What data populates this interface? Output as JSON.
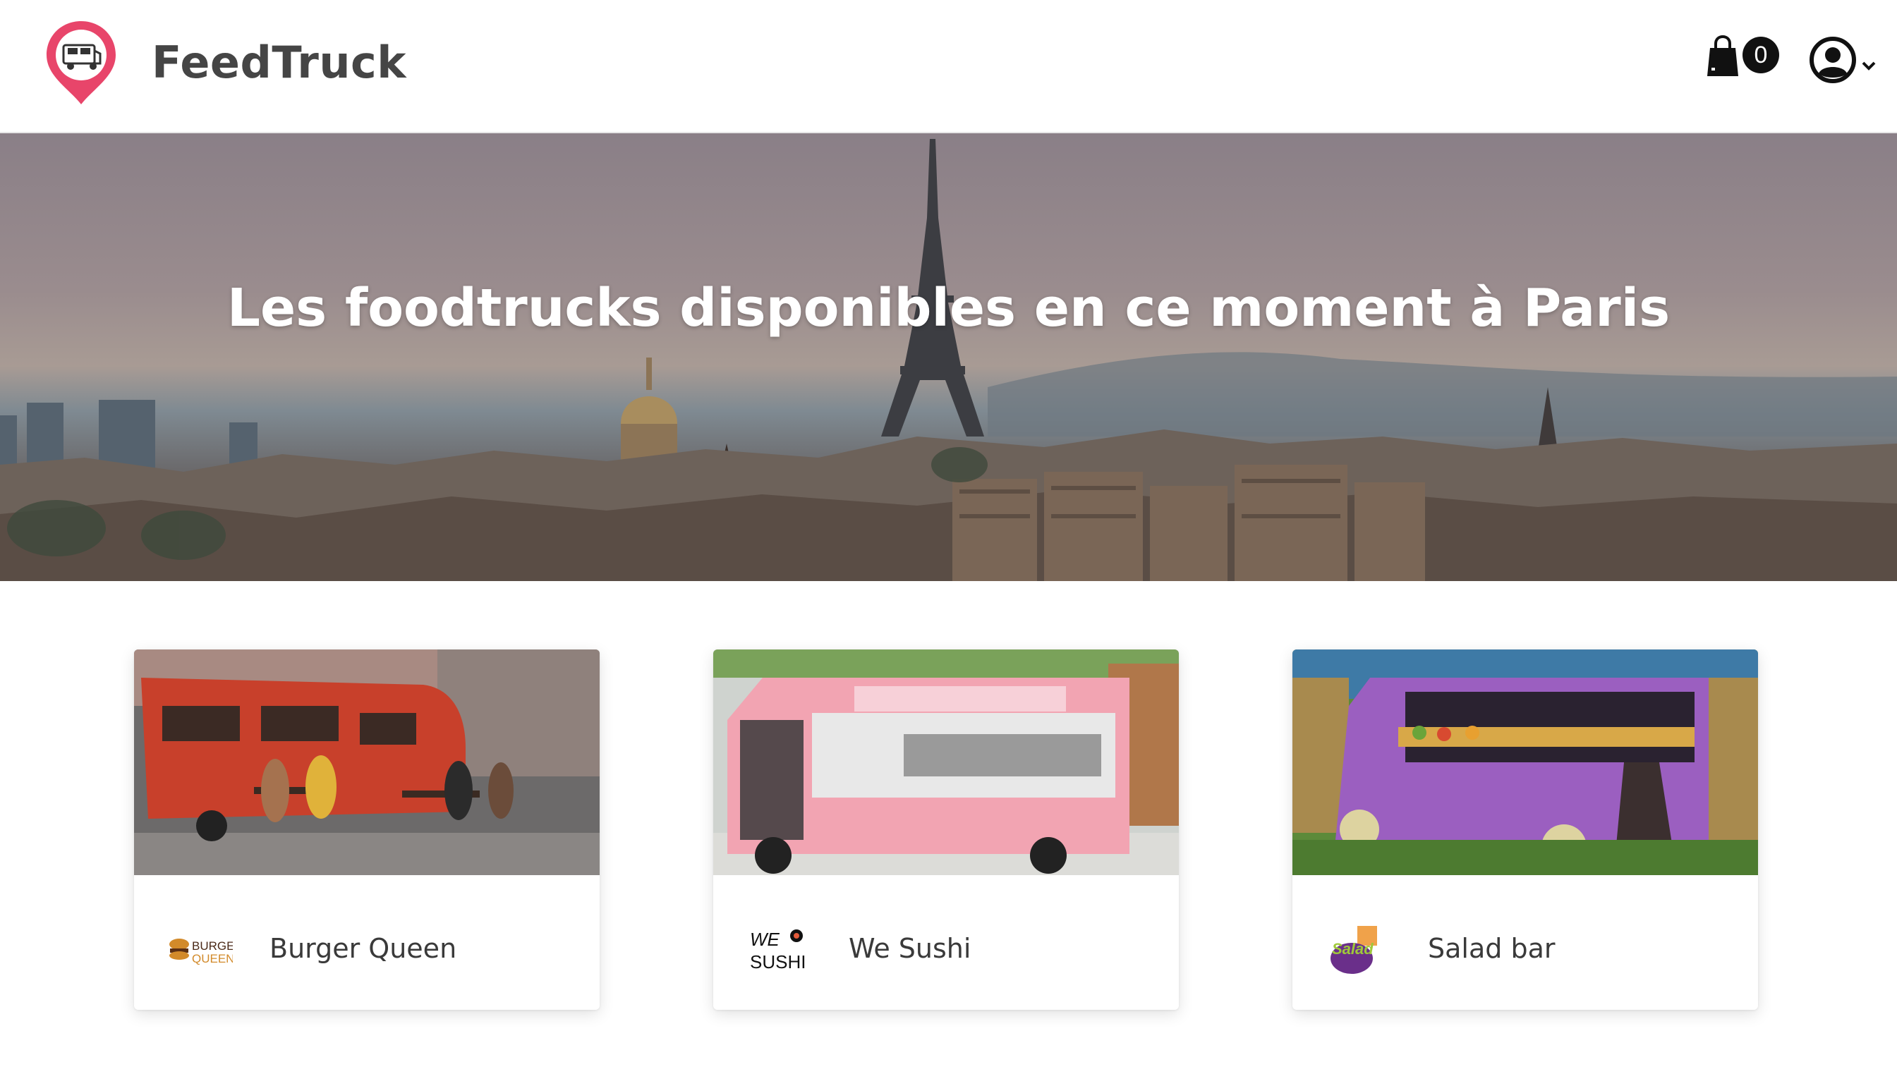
{
  "app": {
    "brand": "FeedTruck"
  },
  "header": {
    "cart_count": "0",
    "icons": [
      "foodtruck-pin-logo",
      "shopping-bag-icon",
      "user-account-icon",
      "chevron-down-icon"
    ]
  },
  "hero": {
    "title": "Les foodtrucks disponibles en ce moment à Paris"
  },
  "trucks": [
    {
      "name": "Burger Queen",
      "logo_text": [
        "BURGER",
        "QUEEN"
      ],
      "accent": "#c8402b"
    },
    {
      "name": "We Sushi",
      "logo_text": [
        "WE",
        "SUSHI"
      ],
      "accent": "#f4a0b0"
    },
    {
      "name": "Salad bar",
      "logo_text": [
        "Salad"
      ],
      "accent": "#9b5fc0"
    }
  ],
  "colors": {
    "brand_pink": "#e8456a",
    "text_dark": "#454545"
  }
}
